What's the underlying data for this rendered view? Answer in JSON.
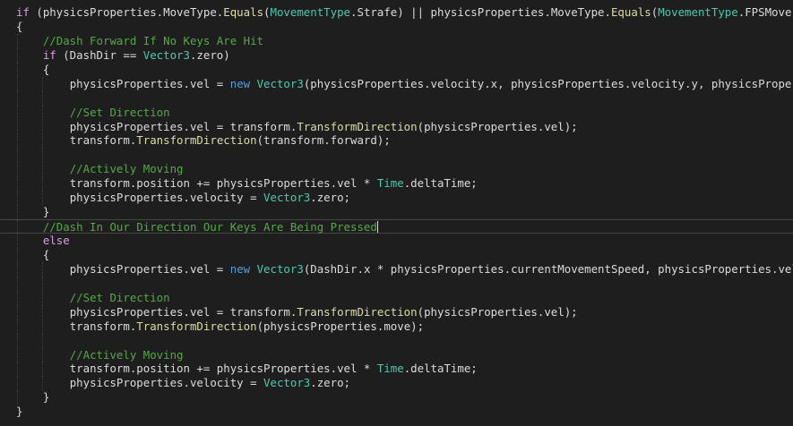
{
  "editor": {
    "theme": {
      "background": "#1e1e1e",
      "text": "#dcdcdc",
      "keyword": "#569cd6",
      "control_keyword": "#d8a0df",
      "type": "#4ec9b0",
      "method": "#dcdcaa",
      "comment": "#57a64a"
    },
    "lines": [
      {
        "indent": 0,
        "active": false,
        "tokens": [
          {
            "t": "if",
            "c": "kc"
          },
          {
            "t": " (physicsProperties.MoveType.",
            "c": "pl"
          },
          {
            "t": "Equals",
            "c": "fn"
          },
          {
            "t": "(",
            "c": "pl"
          },
          {
            "t": "MovementType",
            "c": "ty"
          },
          {
            "t": ".Strafe) || physicsProperties.MoveType.",
            "c": "pl"
          },
          {
            "t": "Equals",
            "c": "fn"
          },
          {
            "t": "(",
            "c": "pl"
          },
          {
            "t": "MovementType",
            "c": "ty"
          },
          {
            "t": ".FPSMove))",
            "c": "pl"
          }
        ]
      },
      {
        "indent": 0,
        "active": false,
        "tokens": [
          {
            "t": "{",
            "c": "pl"
          }
        ]
      },
      {
        "indent": 1,
        "active": false,
        "tokens": [
          {
            "t": "//Dash Forward If No Keys Are Hit",
            "c": "cm"
          }
        ]
      },
      {
        "indent": 1,
        "active": false,
        "tokens": [
          {
            "t": "if",
            "c": "kc"
          },
          {
            "t": " (DashDir == ",
            "c": "pl"
          },
          {
            "t": "Vector3",
            "c": "ty"
          },
          {
            "t": ".zero)",
            "c": "pl"
          }
        ]
      },
      {
        "indent": 1,
        "active": false,
        "tokens": [
          {
            "t": "{",
            "c": "pl"
          }
        ]
      },
      {
        "indent": 2,
        "active": false,
        "tokens": [
          {
            "t": "physicsProperties.vel = ",
            "c": "pl"
          },
          {
            "t": "new",
            "c": "kw"
          },
          {
            "t": " ",
            "c": "pl"
          },
          {
            "t": "Vector3",
            "c": "ty"
          },
          {
            "t": "(physicsProperties.velocity.x, physicsProperties.velocity.y, physicsProperties.",
            "c": "pl"
          }
        ]
      },
      {
        "indent": 2,
        "active": false,
        "tokens": []
      },
      {
        "indent": 2,
        "active": false,
        "tokens": [
          {
            "t": "//Set Direction",
            "c": "cm"
          }
        ]
      },
      {
        "indent": 2,
        "active": false,
        "tokens": [
          {
            "t": "physicsProperties.vel = transform.",
            "c": "pl"
          },
          {
            "t": "TransformDirection",
            "c": "fn"
          },
          {
            "t": "(physicsProperties.vel);",
            "c": "pl"
          }
        ]
      },
      {
        "indent": 2,
        "active": false,
        "tokens": [
          {
            "t": "transform.",
            "c": "pl"
          },
          {
            "t": "TransformDirection",
            "c": "fn"
          },
          {
            "t": "(transform.forward);",
            "c": "pl"
          }
        ]
      },
      {
        "indent": 2,
        "active": false,
        "tokens": []
      },
      {
        "indent": 2,
        "active": false,
        "tokens": [
          {
            "t": "//Actively Moving",
            "c": "cm"
          }
        ]
      },
      {
        "indent": 2,
        "active": false,
        "tokens": [
          {
            "t": "transform.position += physicsProperties.vel * ",
            "c": "pl"
          },
          {
            "t": "Time",
            "c": "ty"
          },
          {
            "t": ".deltaTime;",
            "c": "pl"
          }
        ]
      },
      {
        "indent": 2,
        "active": false,
        "tokens": [
          {
            "t": "physicsProperties.velocity = ",
            "c": "pl"
          },
          {
            "t": "Vector3",
            "c": "ty"
          },
          {
            "t": ".zero;",
            "c": "pl"
          }
        ]
      },
      {
        "indent": 1,
        "active": false,
        "tokens": [
          {
            "t": "}",
            "c": "pl"
          }
        ]
      },
      {
        "indent": 1,
        "active": true,
        "cursor": true,
        "tokens": [
          {
            "t": "//Dash In Our Direction Our Keys Are Being Pressed",
            "c": "cm"
          }
        ]
      },
      {
        "indent": 1,
        "active": false,
        "tokens": [
          {
            "t": "else",
            "c": "kc"
          }
        ]
      },
      {
        "indent": 1,
        "active": false,
        "tokens": [
          {
            "t": "{",
            "c": "pl"
          }
        ]
      },
      {
        "indent": 2,
        "active": false,
        "tokens": [
          {
            "t": "physicsProperties.vel = ",
            "c": "pl"
          },
          {
            "t": "new",
            "c": "kw"
          },
          {
            "t": " ",
            "c": "pl"
          },
          {
            "t": "Vector3",
            "c": "ty"
          },
          {
            "t": "(DashDir.x * physicsProperties.currentMovementSpeed, physicsProperties.velocit",
            "c": "pl"
          }
        ]
      },
      {
        "indent": 2,
        "active": false,
        "tokens": []
      },
      {
        "indent": 2,
        "active": false,
        "tokens": [
          {
            "t": "//Set Direction",
            "c": "cm"
          }
        ]
      },
      {
        "indent": 2,
        "active": false,
        "tokens": [
          {
            "t": "physicsProperties.vel = transform.",
            "c": "pl"
          },
          {
            "t": "TransformDirection",
            "c": "fn"
          },
          {
            "t": "(physicsProperties.vel);",
            "c": "pl"
          }
        ]
      },
      {
        "indent": 2,
        "active": false,
        "tokens": [
          {
            "t": "transform.",
            "c": "pl"
          },
          {
            "t": "TransformDirection",
            "c": "fn"
          },
          {
            "t": "(physicsProperties.move);",
            "c": "pl"
          }
        ]
      },
      {
        "indent": 2,
        "active": false,
        "tokens": []
      },
      {
        "indent": 2,
        "active": false,
        "tokens": [
          {
            "t": "//Actively Moving",
            "c": "cm"
          }
        ]
      },
      {
        "indent": 2,
        "active": false,
        "tokens": [
          {
            "t": "transform.position += physicsProperties.vel * ",
            "c": "pl"
          },
          {
            "t": "Time",
            "c": "ty"
          },
          {
            "t": ".deltaTime;",
            "c": "pl"
          }
        ]
      },
      {
        "indent": 2,
        "active": false,
        "tokens": [
          {
            "t": "physicsProperties.velocity = ",
            "c": "pl"
          },
          {
            "t": "Vector3",
            "c": "ty"
          },
          {
            "t": ".zero;",
            "c": "pl"
          }
        ]
      },
      {
        "indent": 1,
        "active": false,
        "tokens": [
          {
            "t": "}",
            "c": "pl"
          }
        ]
      },
      {
        "indent": 0,
        "active": false,
        "tokens": [
          {
            "t": "}",
            "c": "pl"
          }
        ]
      }
    ]
  }
}
